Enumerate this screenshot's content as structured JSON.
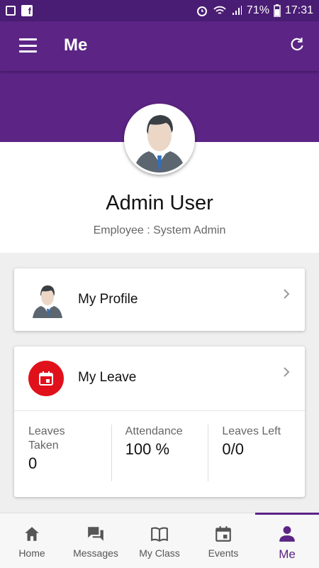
{
  "status_bar": {
    "battery": "71%",
    "time": "17:31"
  },
  "app_bar": {
    "title": "Me"
  },
  "profile": {
    "name": "Admin User",
    "role": "Employee : System Admin"
  },
  "cards": {
    "profile_label": "My Profile",
    "leave_label": "My Leave"
  },
  "leave_stats": [
    {
      "label": "Leaves Taken",
      "value": "0"
    },
    {
      "label": "Attendance",
      "value": "100 %"
    },
    {
      "label": "Leaves Left",
      "value": "0/0"
    }
  ],
  "bottom_nav": [
    {
      "label": "Home",
      "icon": "home-icon"
    },
    {
      "label": "Messages",
      "icon": "chat-icon"
    },
    {
      "label": "My Class",
      "icon": "book-icon"
    },
    {
      "label": "Events",
      "icon": "calendar-icon"
    },
    {
      "label": "Me",
      "icon": "person-icon",
      "active": true
    }
  ],
  "colors": {
    "primary": "#5b2485",
    "accent": "#e0111b"
  }
}
